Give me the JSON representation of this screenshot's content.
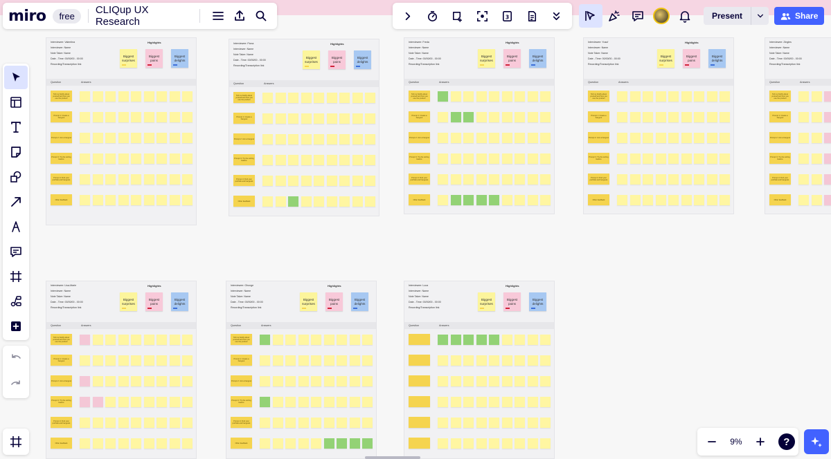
{
  "app": {
    "logo": "miro",
    "plan_badge": "free",
    "board_title": "CLIQup UX Research"
  },
  "toolbar": {
    "present_label": "Present",
    "share_label": "Share"
  },
  "zoom": {
    "value": "9%",
    "help_label": "?"
  },
  "highlights": {
    "title": "Highlights",
    "surprises": "Biggest surprises",
    "pains": "Biggest pains",
    "delights": "Biggest delights"
  },
  "table_headers": {
    "question": "Question",
    "answers": "Answers"
  },
  "meta_labels": {
    "interviewer": "Interviewer: Name",
    "note_taker": "Note Taker: Name",
    "date_time": "Date - Time: 00/00/00 - 00:00",
    "recording": "Recording/Transcription link"
  },
  "questions": [
    "Tell me briefly about yourself and how you use the product",
    "Prompt 1: Create a hangout",
    "Prompt 2: Join a hangout",
    "Prompt 3: Try the sorting feature",
    "Prompt 4: Find your portfolio and hangouts",
    "Other feedback"
  ],
  "frames": [
    {
      "interviewee": "Interviewee: Valentina"
    },
    {
      "interviewee": "Interviewee: Fiona"
    },
    {
      "interviewee": "Interviewee: Freda"
    },
    {
      "interviewee": "Interviewee: Yusuf"
    },
    {
      "interviewee": "Interviewee: Zingles"
    },
    {
      "interviewee": "Interviewee: Lisa-Marie"
    },
    {
      "interviewee": "Interviewee: Ghunge"
    },
    {
      "interviewee": "Interviewee: Luca"
    }
  ],
  "colors": {
    "accent": "#4262ff",
    "selection": "#dde3ff",
    "sticky_yellow": "#fff6a2",
    "sticky_dark_yellow": "#f5d44f",
    "sticky_green": "#93d275",
    "sticky_pink": "#f4c7d6"
  },
  "icons": {
    "top_left": [
      "menu-icon",
      "export-icon",
      "search-icon"
    ],
    "top_center": [
      "chevron-right-icon",
      "timer-icon",
      "sticky-add-icon",
      "focus-icon",
      "frames-count-icon",
      "notes-icon",
      "chevron-double-down-icon"
    ],
    "top_right": [
      "select-cursor-icon",
      "reactions-icon",
      "comment-icon",
      "notifications-icon"
    ],
    "left_toolbar": [
      "select-icon",
      "templates-icon",
      "text-icon",
      "sticky-note-icon",
      "shapes-icon",
      "arrow-icon",
      "pen-icon",
      "comment-icon",
      "frame-icon",
      "mindmap-icon",
      "more-apps-icon"
    ]
  }
}
